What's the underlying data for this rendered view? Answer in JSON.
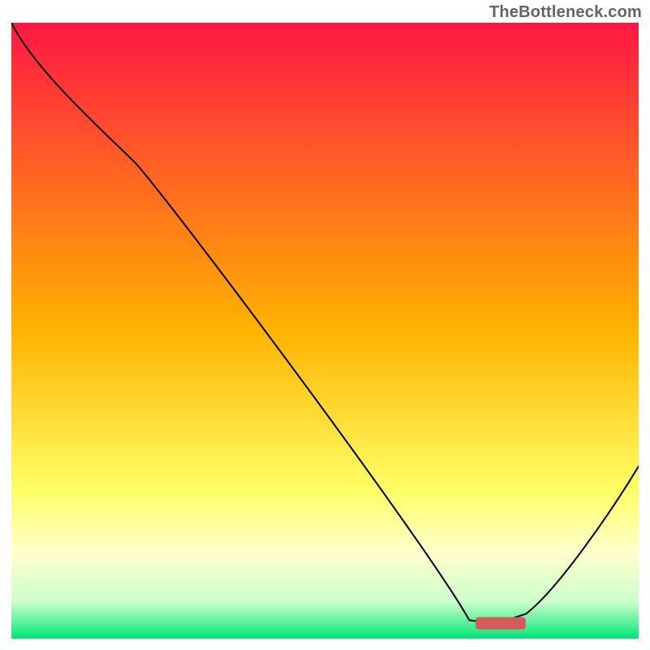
{
  "watermark": "TheBottleneck.com",
  "chart_data": {
    "type": "line",
    "title": "",
    "xlabel": "",
    "ylabel": "",
    "xlim": [
      0,
      100
    ],
    "ylim": [
      0,
      100
    ],
    "grid": false,
    "legend": false,
    "series": [
      {
        "name": "bottleneck-curve",
        "x": [
          0,
          20,
          73,
          78,
          82,
          100
        ],
        "y": [
          100,
          77,
          3,
          3,
          4,
          28
        ]
      }
    ],
    "annotations": [
      {
        "name": "optimal-marker",
        "type": "rounded-rect",
        "x_center": 78,
        "y_center": 2.5,
        "width": 8,
        "height": 2,
        "color": "#d75a5a"
      }
    ],
    "background_gradient": {
      "stops": [
        {
          "offset": 0.0,
          "color": "#ff1744"
        },
        {
          "offset": 0.5,
          "color": "#ffb300"
        },
        {
          "offset": 0.76,
          "color": "#ffff66"
        },
        {
          "offset": 0.86,
          "color": "#ffffcc"
        },
        {
          "offset": 0.94,
          "color": "#ccffcc"
        },
        {
          "offset": 1.0,
          "color": "#00e676"
        }
      ]
    },
    "curve_color": "#000000",
    "curve_width": 2
  }
}
